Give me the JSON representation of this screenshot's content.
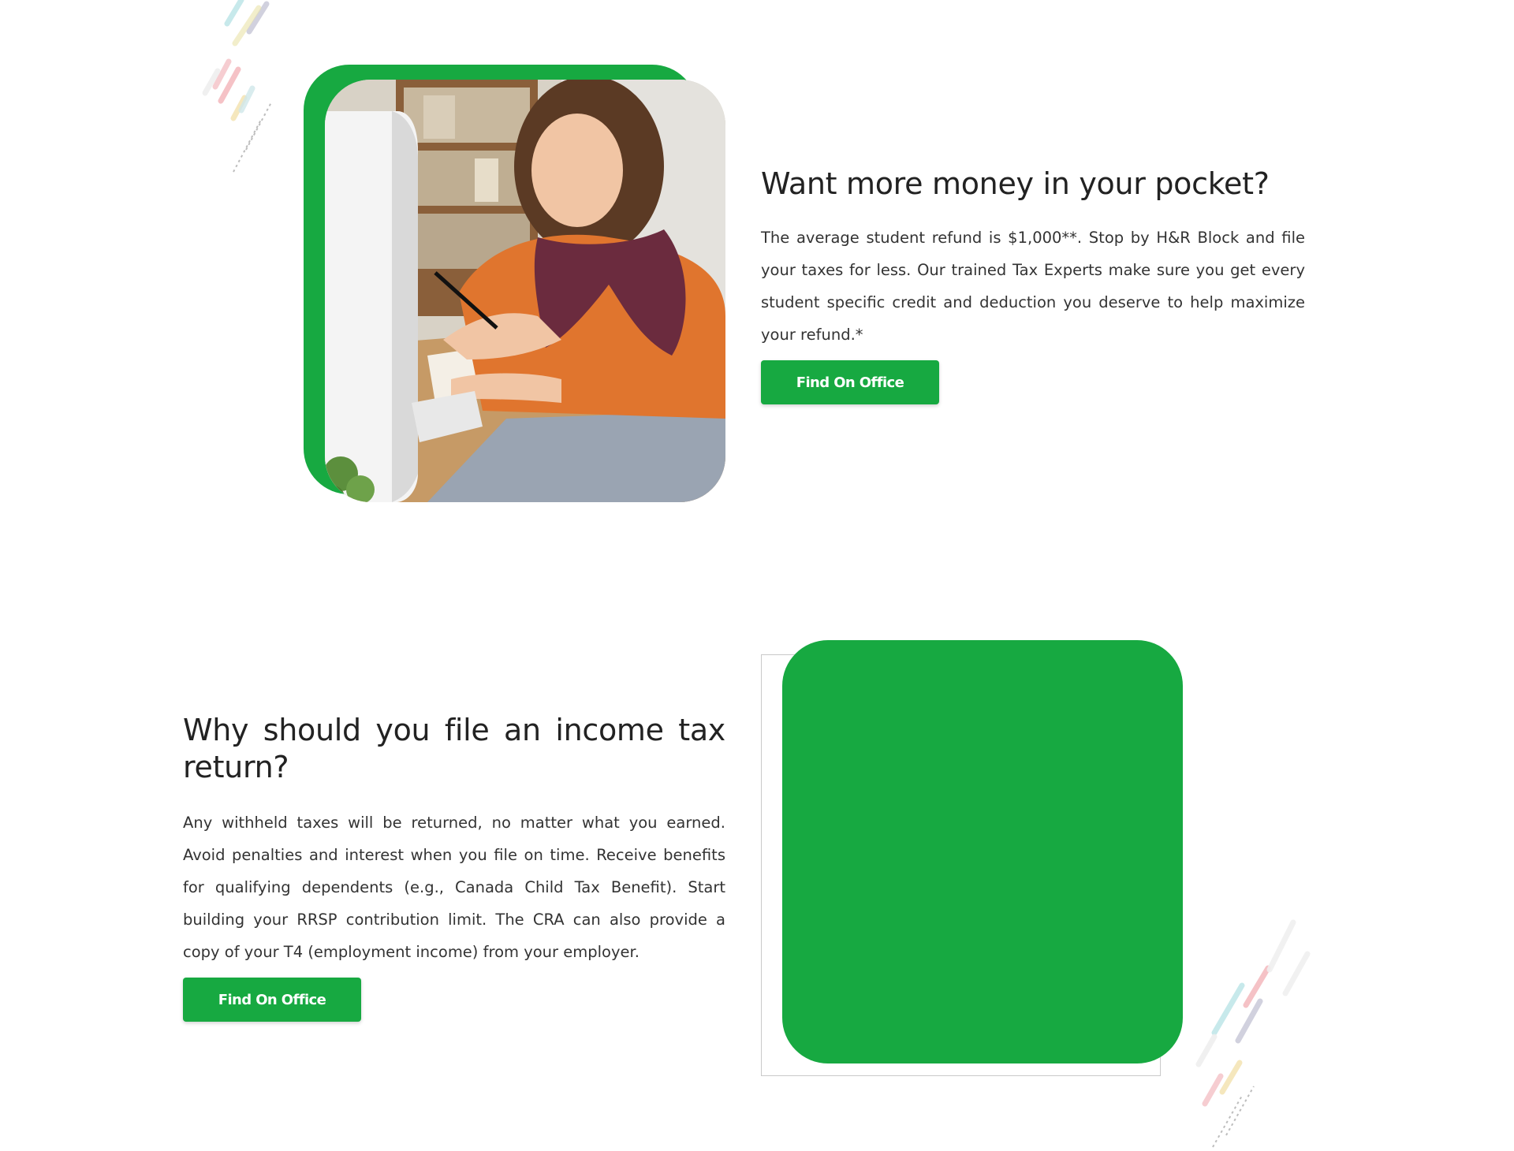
{
  "section_refund": {
    "heading": "Want more money in your pocket?",
    "body": "The average student refund is $1,000**. Stop by H&R Block and file your taxes for less. Our trained Tax Experts make sure you get every student specific credit and deduction you deserve to help maximize your refund.*",
    "button_label": "Find On Office",
    "image_alt": "Smiling student writing notes at a desk in front of a computer"
  },
  "section_why_file": {
    "heading": "Why should you file an income tax return?",
    "body": "Any withheld taxes will be returned, no matter what you earned. Avoid penalties and interest when you file on time. Receive benefits for qualifying dependents (e.g., Canada Child Tax Benefit). Start building your RRSP contribution limit. The CRA can also provide a copy of your T4 (employment income) from your employer.",
    "button_label": "Find On Office"
  },
  "colors": {
    "accent_green": "#17a941",
    "heading_text": "#222222",
    "body_text": "#333333",
    "button_text": "#ffffff"
  },
  "icons": [
    "decorative-dash-pattern"
  ]
}
